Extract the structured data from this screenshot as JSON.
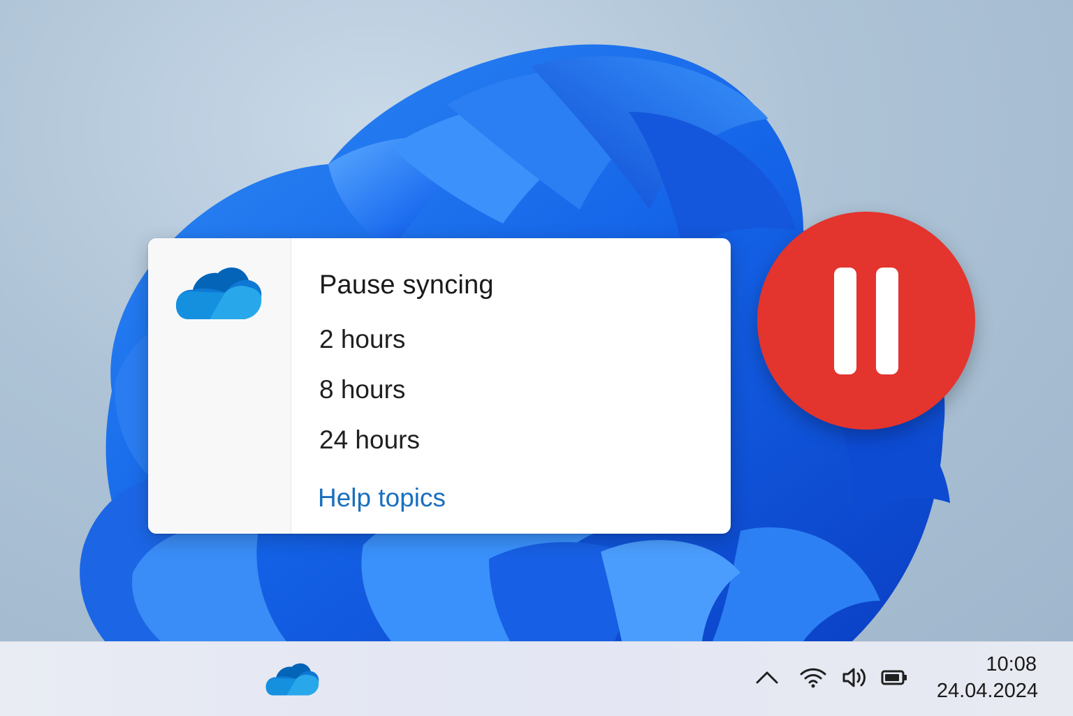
{
  "flyout": {
    "title": "Pause syncing",
    "options": [
      "2 hours",
      "8 hours",
      "24 hours"
    ],
    "help_link": "Help topics"
  },
  "taskbar": {
    "app_icon": "onedrive-cloud-icon",
    "tray_icons": [
      "chevron-up-icon",
      "wifi-icon",
      "volume-icon",
      "battery-icon"
    ],
    "clock": {
      "time": "10:08",
      "date": "24.04.2024"
    }
  },
  "badge": {
    "icon": "pause-icon",
    "color": "#e3342e"
  },
  "colors": {
    "link": "#1a6fbd",
    "onedrive_blue": "#0f78d4",
    "wallpaper_blue": "#1a63e6"
  }
}
